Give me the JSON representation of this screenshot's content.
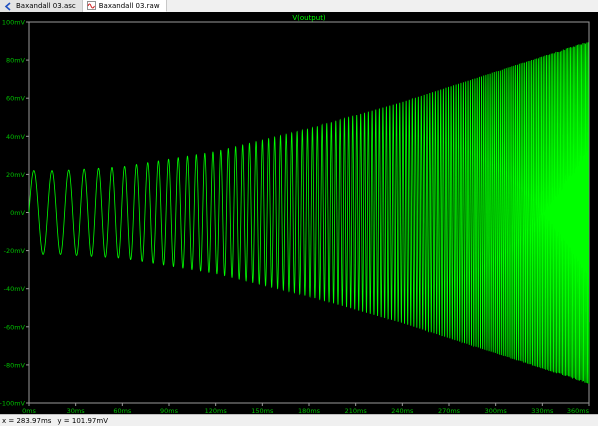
{
  "tabs": [
    {
      "label": "Baxandall 03.asc",
      "icon": "schematic-icon",
      "active": false
    },
    {
      "label": "Baxandall 03.raw",
      "icon": "waveform-icon",
      "active": true
    }
  ],
  "status": {
    "x_readout": "x = 283.97ms",
    "y_readout": "y = 101.97mV"
  },
  "colors": {
    "background": "#000000",
    "trace": "#00ff00",
    "axis_labels": "#00c000",
    "grid": "#303030"
  },
  "chart_data": {
    "type": "line",
    "title": "V(output)",
    "xlabel": "",
    "ylabel": "",
    "xlim": [
      0,
      360
    ],
    "ylim": [
      -100,
      100
    ],
    "x_unit": "ms",
    "y_unit": "mV",
    "x_ticks": [
      "0ms",
      "30ms",
      "60ms",
      "90ms",
      "120ms",
      "150ms",
      "180ms",
      "210ms",
      "240ms",
      "270ms",
      "300ms",
      "330ms",
      "360ms"
    ],
    "y_ticks": [
      "100mV",
      "80mV",
      "60mV",
      "40mV",
      "20mV",
      "0mV",
      "-20mV",
      "-40mV",
      "-60mV",
      "-80mV",
      "-100mV"
    ],
    "grid": false,
    "series": [
      {
        "name": "V(output)",
        "description_amplitude_mV": {
          "x": [
            0,
            20,
            60,
            120,
            180,
            240,
            300,
            360
          ],
          "y": [
            22,
            22,
            24,
            32,
            44,
            58,
            74,
            90
          ]
        },
        "frequency_start_Hz": 80,
        "frequency_end_Hz": 1200
      }
    ]
  }
}
